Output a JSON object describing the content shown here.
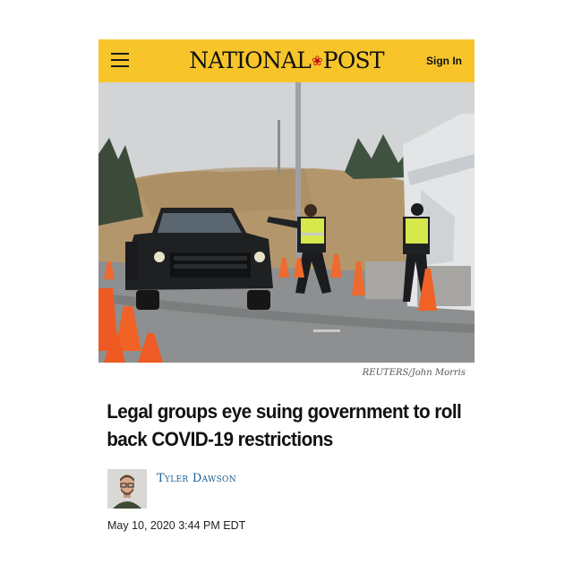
{
  "header": {
    "brand": "NATIONAL POST",
    "brand_left": "NATIONAL",
    "brand_right": "POST",
    "signin_label": "Sign In",
    "accent_color": "#f7c52a"
  },
  "photo": {
    "credit": "REUTERS/John Morris"
  },
  "article": {
    "headline": "Legal groups eye suing government to roll back COVID-19 restrictions",
    "author": "Tyler Dawson",
    "date": "May 10, 2020 3:44 PM EDT"
  },
  "icons": [
    "hamburger-menu-icon",
    "maple-leaf-icon"
  ]
}
